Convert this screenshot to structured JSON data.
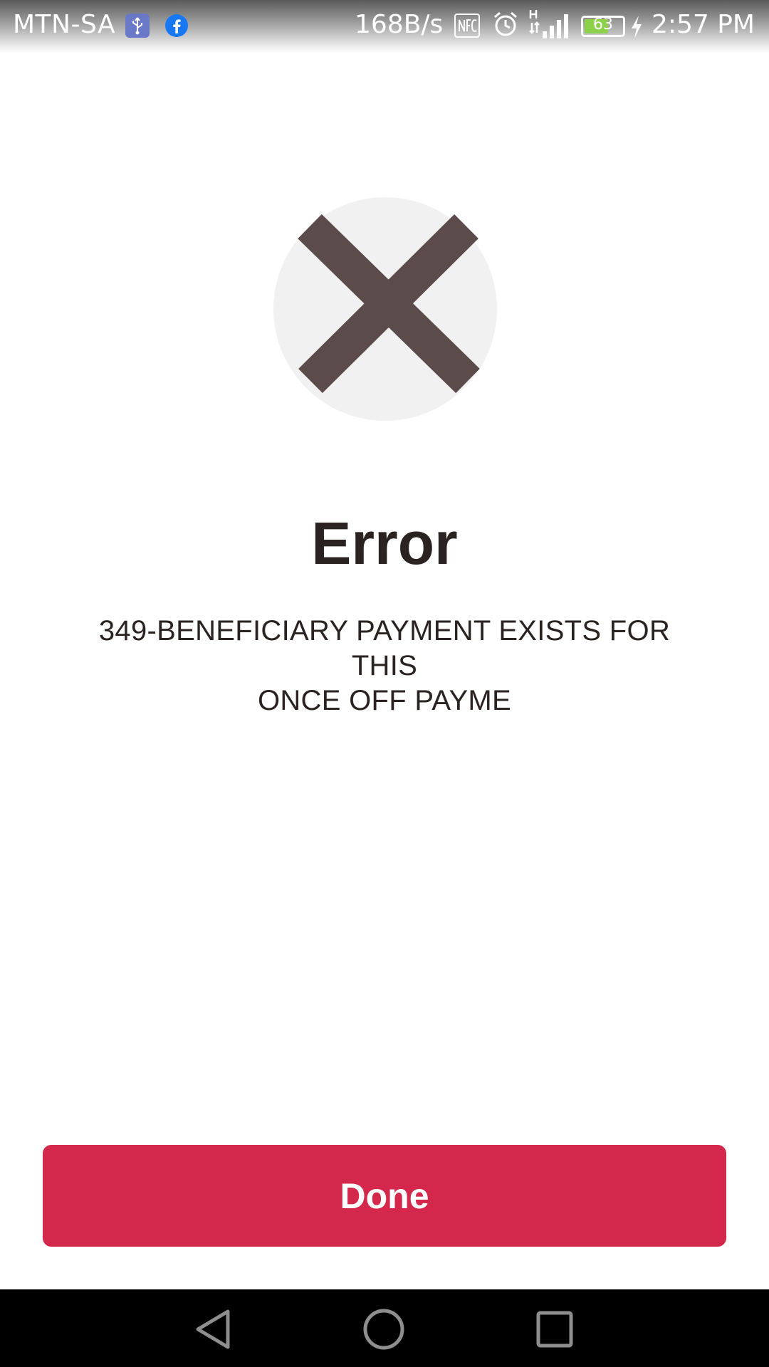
{
  "status_bar": {
    "carrier": "MTN-SA",
    "net_speed": "168B/s",
    "battery_level": "63",
    "battery_percent": 63,
    "time": "2:57 PM",
    "icons": [
      "usb-icon",
      "facebook-icon",
      "nfc-icon",
      "alarm-icon",
      "signal-icon",
      "battery-icon",
      "charging-icon"
    ]
  },
  "dialog": {
    "icon": "error-x-icon",
    "title": "Error",
    "message_line1": "349-BENEFICIARY PAYMENT EXISTS FOR THIS",
    "message_line2": "ONCE OFF PAYME",
    "button_label": "Done"
  },
  "navigation": {
    "buttons": [
      "back-icon",
      "home-icon",
      "recents-icon"
    ]
  },
  "colors": {
    "accent": "#d3284c",
    "icon_circle": "#f1f1f1",
    "icon_cross": "#5b4b4b",
    "text": "#2b2222"
  }
}
